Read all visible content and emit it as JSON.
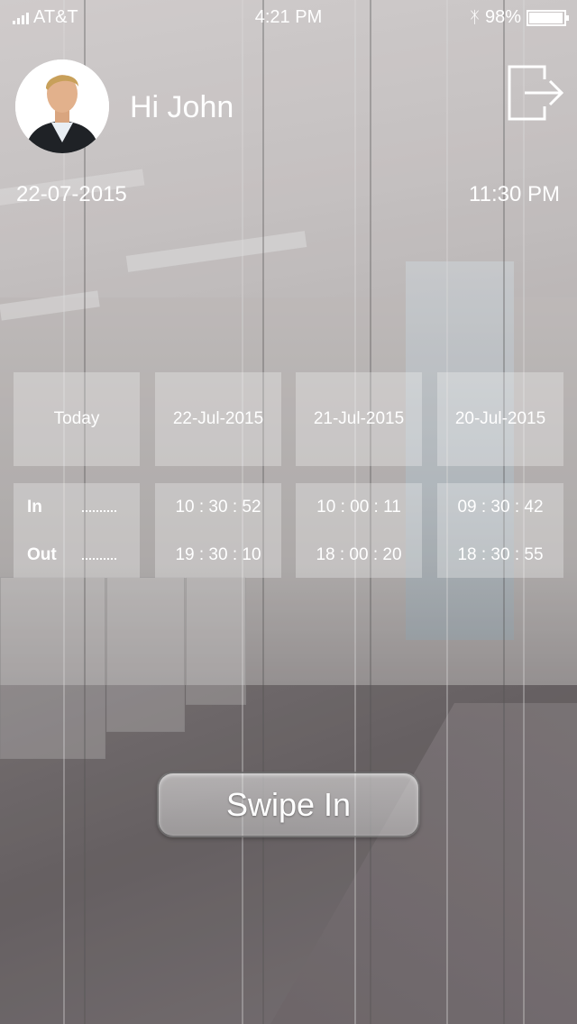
{
  "status_bar": {
    "carrier": "AT&T",
    "time": "4:21 PM",
    "bluetooth_icon": "bluetooth-icon",
    "battery_text": "98%",
    "battery_level": 0.98
  },
  "header": {
    "greeting": "Hi John",
    "avatar_icon": "user-avatar",
    "logout_icon": "logout-icon",
    "date": "22-07-2015",
    "time": "11:30 PM"
  },
  "attendance": {
    "in_label": "In",
    "out_label": "Out",
    "days": [
      {
        "label": "Today",
        "in": "",
        "out": ""
      },
      {
        "label": "22-Jul-2015",
        "in": "10 : 30 : 52",
        "out": "19 : 30 : 10"
      },
      {
        "label": "21-Jul-2015",
        "in": "10 : 00 : 11",
        "out": "18 : 00 : 20"
      },
      {
        "label": "20-Jul-2015",
        "in": "09 : 30 : 42",
        "out": "18 : 30 : 55"
      }
    ]
  },
  "swipe_button": {
    "label": "Swipe In"
  }
}
